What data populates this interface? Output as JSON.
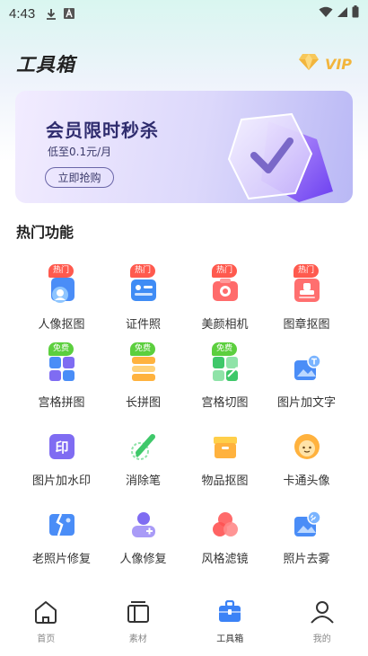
{
  "status_bar": {
    "time": "4:43"
  },
  "header": {
    "title": "工具箱",
    "vip_label": "VIP"
  },
  "banner": {
    "title": "会员限时秒杀",
    "subtitle": "低至0.1元/月",
    "button": "立即抢购"
  },
  "section": {
    "title": "热门功能"
  },
  "tools": [
    {
      "label": "人像抠图",
      "badge": "热门",
      "badge_color": "#ff5a4e",
      "icon": "portrait-cutout-icon"
    },
    {
      "label": "证件照",
      "badge": "热门",
      "badge_color": "#ff5a4e",
      "icon": "id-photo-icon"
    },
    {
      "label": "美颜相机",
      "badge": "热门",
      "badge_color": "#ff5a4e",
      "icon": "beauty-camera-icon"
    },
    {
      "label": "图章抠图",
      "badge": "热门",
      "badge_color": "#ff5a4e",
      "icon": "stamp-cutout-icon"
    },
    {
      "label": "宫格拼图",
      "badge": "免费",
      "badge_color": "#5ccf3e",
      "icon": "grid-collage-icon"
    },
    {
      "label": "长拼图",
      "badge": "免费",
      "badge_color": "#5ccf3e",
      "icon": "long-collage-icon"
    },
    {
      "label": "宫格切图",
      "badge": "免费",
      "badge_color": "#5ccf3e",
      "icon": "grid-cut-icon"
    },
    {
      "label": "图片加文字",
      "badge": "",
      "badge_color": "",
      "icon": "add-text-icon"
    },
    {
      "label": "图片加水印",
      "badge": "",
      "badge_color": "",
      "icon": "watermark-icon"
    },
    {
      "label": "消除笔",
      "badge": "",
      "badge_color": "",
      "icon": "eraser-pen-icon"
    },
    {
      "label": "物品抠图",
      "badge": "",
      "badge_color": "",
      "icon": "object-cutout-icon"
    },
    {
      "label": "卡通头像",
      "badge": "",
      "badge_color": "",
      "icon": "cartoon-avatar-icon"
    },
    {
      "label": "老照片修复",
      "badge": "",
      "badge_color": "",
      "icon": "old-photo-repair-icon"
    },
    {
      "label": "人像修复",
      "badge": "",
      "badge_color": "",
      "icon": "portrait-repair-icon"
    },
    {
      "label": "风格滤镜",
      "badge": "",
      "badge_color": "",
      "icon": "style-filter-icon"
    },
    {
      "label": "照片去雾",
      "badge": "",
      "badge_color": "",
      "icon": "dehaze-icon"
    }
  ],
  "tabbar": {
    "items": [
      {
        "label": "首页",
        "icon": "home-icon",
        "active": false
      },
      {
        "label": "素材",
        "icon": "materials-icon",
        "active": false
      },
      {
        "label": "工具箱",
        "icon": "toolbox-icon",
        "active": true
      },
      {
        "label": "我的",
        "icon": "profile-icon",
        "active": false
      }
    ]
  },
  "colors": {
    "accent_red": "#ff5a4e",
    "accent_green": "#5ccf3e",
    "vip_gold": "#f2b53c",
    "active_tab": "#3b82f6"
  }
}
